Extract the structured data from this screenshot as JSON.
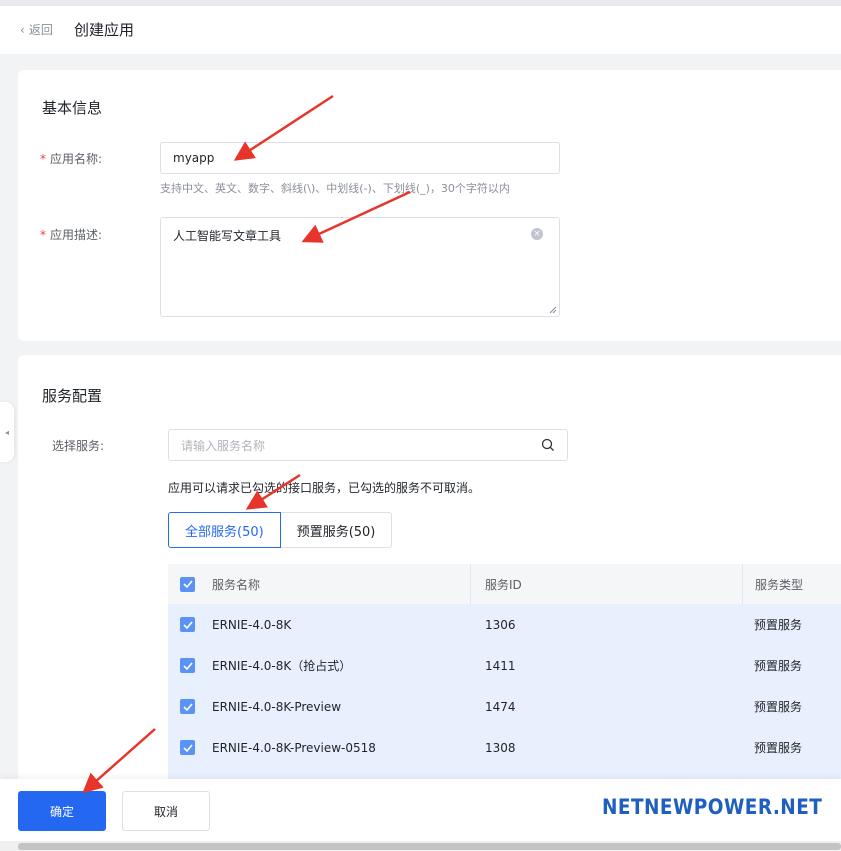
{
  "header": {
    "back_label": "返回",
    "title": "创建应用"
  },
  "basic_info": {
    "title": "基本信息",
    "name_label": "应用名称:",
    "name_value": "myapp",
    "name_hint": "支持中文、英文、数字、斜线(\\)、中划线(-)、下划线(_)，30个字符以内",
    "desc_label": "应用描述:",
    "desc_value": "人工智能写文章工具"
  },
  "service_config": {
    "title": "服务配置",
    "select_label": "选择服务:",
    "search_placeholder": "请输入服务名称",
    "description": "应用可以请求已勾选的接口服务，已勾选的服务不可取消。",
    "tabs": [
      {
        "label": "全部服务(50)",
        "active": true
      },
      {
        "label": "预置服务(50)",
        "active": false
      }
    ],
    "table": {
      "headers": {
        "name": "服务名称",
        "id": "服务ID",
        "type": "服务类型"
      },
      "rows": [
        {
          "name": "ERNIE-4.0-8K",
          "id": "1306",
          "type": "预置服务",
          "checked": true
        },
        {
          "name": "ERNIE-4.0-8K（抢占式）",
          "id": "1411",
          "type": "预置服务",
          "checked": true
        },
        {
          "name": "ERNIE-4.0-8K-Preview",
          "id": "1474",
          "type": "预置服务",
          "checked": true
        },
        {
          "name": "ERNIE-4.0-8K-Preview-0518",
          "id": "1308",
          "type": "预置服务",
          "checked": true
        }
      ]
    }
  },
  "footer": {
    "confirm_label": "确定",
    "cancel_label": "取消",
    "watermark": "NETNEWPOWER.NET"
  },
  "colors": {
    "primary": "#2468f2",
    "row_selected": "#e8f0fe",
    "required": "#e8453c",
    "annotation_arrow": "#e8352b",
    "watermark": "#1f5fbf"
  },
  "icons": [
    "chevron-left-icon",
    "clear-icon",
    "search-icon",
    "checkbox-checked-icon",
    "collapse-handle-icon",
    "annotation-arrow-icon"
  ]
}
